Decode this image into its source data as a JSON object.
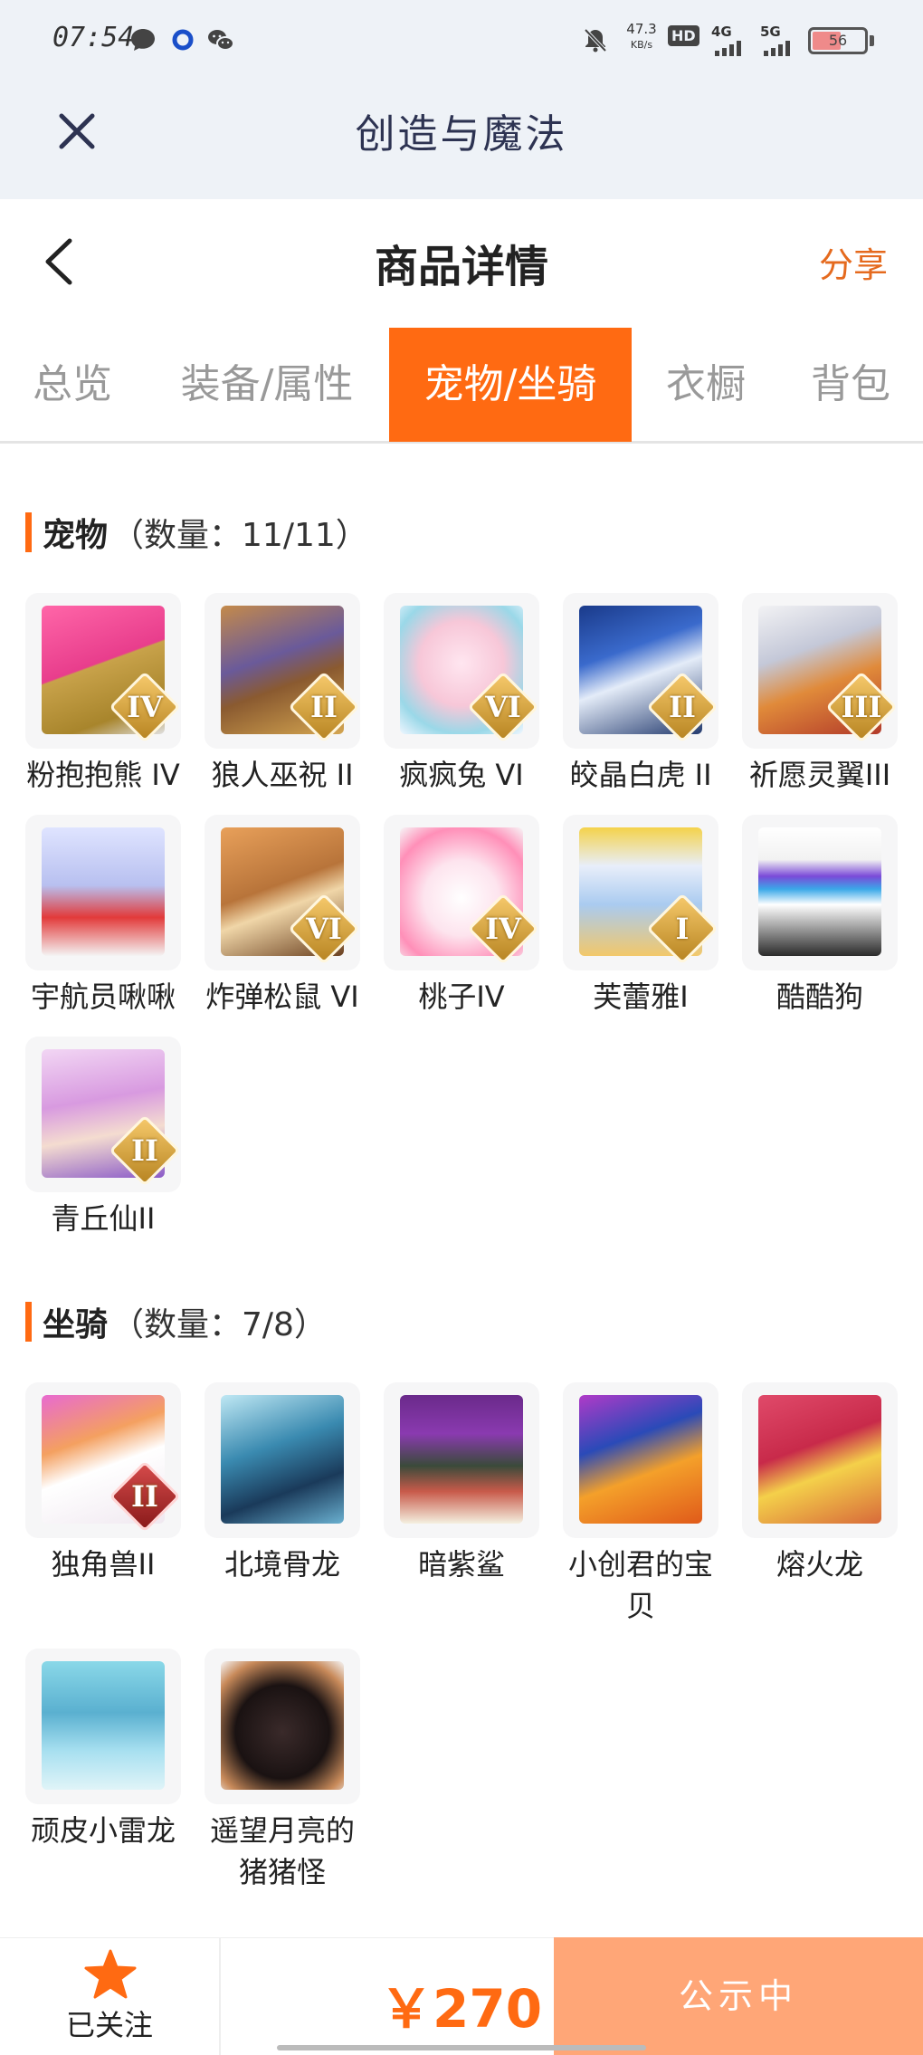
{
  "status_bar": {
    "time": "07:54",
    "net_speed": "47.3",
    "net_unit": "KB/s",
    "hd": "HD",
    "net_4g": "4G",
    "net_5g": "5G",
    "battery": "56",
    "battery_level": 0.56
  },
  "app": {
    "title": "创造与魔法"
  },
  "header": {
    "title": "商品详情",
    "share": "分享"
  },
  "tabs": [
    {
      "label": "总览"
    },
    {
      "label": "装备/属性"
    },
    {
      "label": "宠物/坐骑",
      "active": true
    },
    {
      "label": "衣橱"
    },
    {
      "label": "背包"
    }
  ],
  "pets": {
    "title": "宠物",
    "count": "（数量：11/11）",
    "items": [
      {
        "label": "粉抱抱熊 IV",
        "rank": "IV",
        "icon": "pink-bear"
      },
      {
        "label": "狼人巫祝 II",
        "rank": "II",
        "icon": "werewolf-shaman"
      },
      {
        "label": "疯疯兔 VI",
        "rank": "VI",
        "icon": "crazy-rabbit"
      },
      {
        "label": "皎晶白虎 II",
        "rank": "II",
        "icon": "crystal-white-tiger"
      },
      {
        "label": "祈愿灵翼III",
        "rank": "III",
        "icon": "wish-spirit-wing"
      },
      {
        "label": "宇航员啾啾",
        "rank": "",
        "icon": "astronaut-jiujiu"
      },
      {
        "label": "炸弹松鼠 VI",
        "rank": "VI",
        "icon": "bomb-squirrel"
      },
      {
        "label": "桃子IV",
        "rank": "IV",
        "icon": "peach-cat"
      },
      {
        "label": "芙蕾雅I",
        "rank": "I",
        "icon": "freya"
      },
      {
        "label": "酷酷狗",
        "rank": "",
        "icon": "cool-dog"
      },
      {
        "label": "青丘仙II",
        "rank": "II",
        "icon": "qingqiu-fairy"
      }
    ]
  },
  "mounts": {
    "title": "坐骑",
    "count": "（数量：7/8）",
    "items": [
      {
        "label": "独角兽II",
        "rank": "II",
        "icon": "unicorn"
      },
      {
        "label": "北境骨龙",
        "rank": "",
        "icon": "north-bone-dragon"
      },
      {
        "label": "暗紫鲨",
        "rank": "",
        "icon": "dark-purple-shark"
      },
      {
        "label": "小创君的宝贝",
        "label_line1": "小创君的宝",
        "label_line2": "贝",
        "rank": "",
        "icon": "little-phoenix"
      },
      {
        "label": "熔火龙",
        "rank": "",
        "icon": "magma-dragon"
      },
      {
        "label": "顽皮小雷龙",
        "rank": "",
        "icon": "naughty-thunder-dragon"
      },
      {
        "label": "遥望月亮的猪猪怪",
        "label_line1": "遥望月亮的",
        "label_line2": "猪猪怪",
        "rank": "",
        "icon": "moon-gazing-pig"
      }
    ]
  },
  "bottom": {
    "follow_label": "已关注",
    "price": "￥270",
    "status": "公示中"
  },
  "colors": {
    "accent": "#ff6a12",
    "share": "#e56a1e",
    "status_button": "#ffa677"
  }
}
